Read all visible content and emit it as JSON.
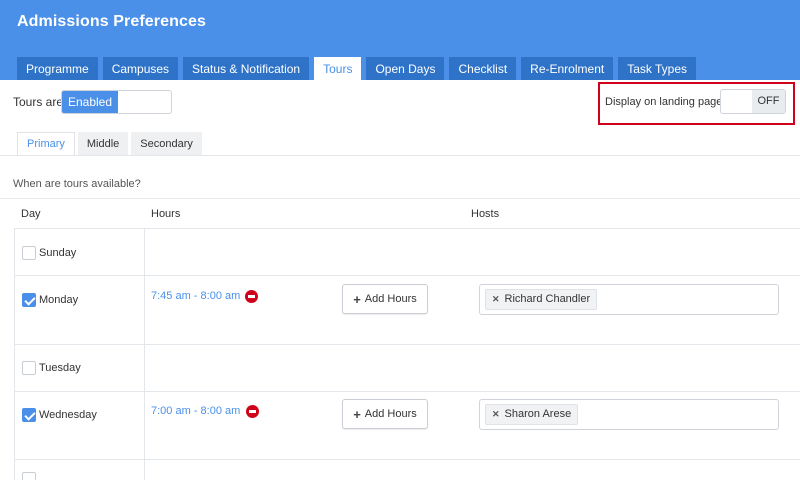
{
  "header": {
    "title": "Admissions Preferences",
    "tabs": [
      {
        "label": "Programme",
        "active": false
      },
      {
        "label": "Campuses",
        "active": false
      },
      {
        "label": "Status & Notification",
        "active": false
      },
      {
        "label": "Tours",
        "active": true
      },
      {
        "label": "Open Days",
        "active": false
      },
      {
        "label": "Checklist",
        "active": false
      },
      {
        "label": "Re-Enrolment",
        "active": false
      },
      {
        "label": "Task Types",
        "active": false
      }
    ]
  },
  "settings": {
    "tours_are_label": "Tours are",
    "enabled_state": "Enabled",
    "display_landing_label": "Display on landing page",
    "display_landing_state": "OFF"
  },
  "school_tabs": [
    {
      "label": "Primary",
      "active": true
    },
    {
      "label": "Middle",
      "active": false
    },
    {
      "label": "Secondary",
      "active": false
    }
  ],
  "question": "When are tours available?",
  "columns": {
    "day": "Day",
    "hours": "Hours",
    "hosts": "Hosts"
  },
  "add_hours_label": "Add Hours",
  "days": [
    {
      "name": "Sunday",
      "checked": false
    },
    {
      "name": "Monday",
      "checked": true,
      "hours": "7:45 am - 8:00 am",
      "host": "Richard Chandler"
    },
    {
      "name": "Tuesday",
      "checked": false
    },
    {
      "name": "Wednesday",
      "checked": true,
      "hours": "7:00 am - 8:00 am",
      "host": "Sharon Arese"
    }
  ],
  "colors": {
    "accent": "#4a90e9",
    "tab_dark": "#2f73c9",
    "alert": "#d0021b"
  }
}
